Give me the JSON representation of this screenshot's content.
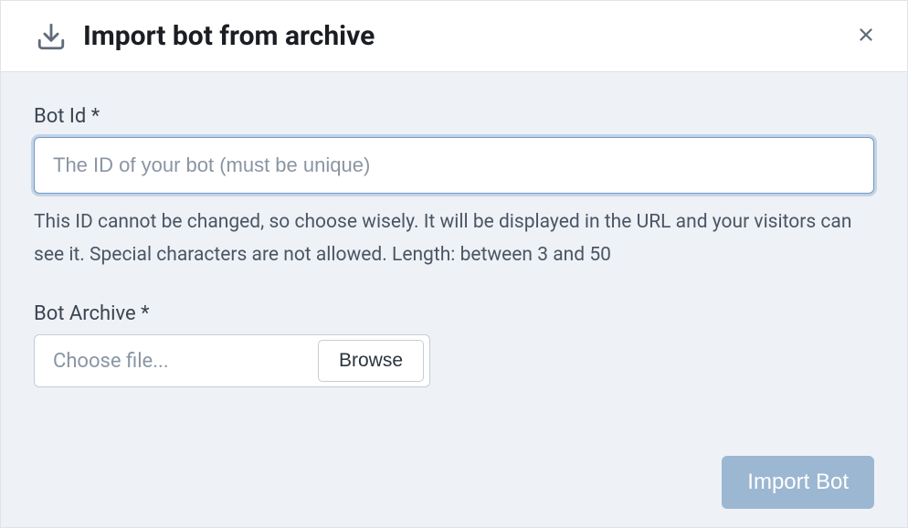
{
  "header": {
    "title": "Import bot from archive"
  },
  "form": {
    "botId": {
      "label": "Bot Id *",
      "placeholder": "The ID of your bot (must be unique)",
      "value": "",
      "help": "This ID cannot be changed, so choose wisely. It will be displayed in the URL and your visitors can see it. Special characters are not allowed. Length: between 3 and 50"
    },
    "archive": {
      "label": "Bot Archive *",
      "placeholder": "Choose file...",
      "browse": "Browse"
    }
  },
  "actions": {
    "submit": "Import Bot"
  }
}
